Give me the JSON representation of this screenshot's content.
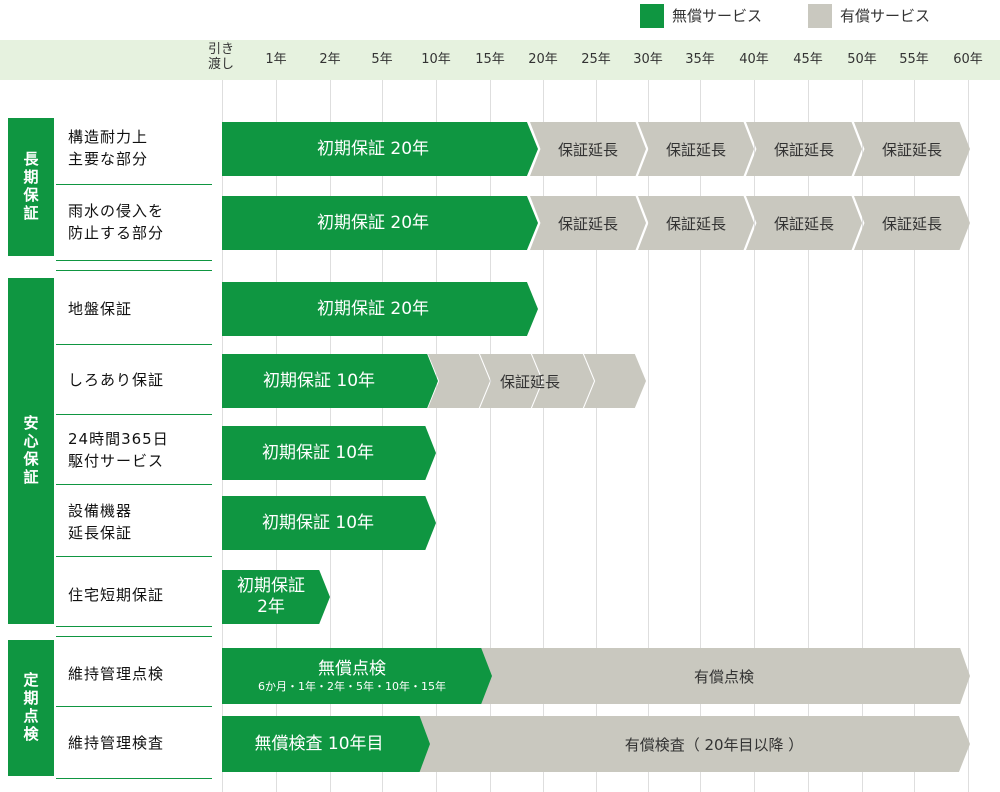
{
  "legend": {
    "free_label": "無償サービス",
    "paid_label": "有償サービス",
    "free_color": "#0f9641",
    "paid_color": "#c9c8bf"
  },
  "timeline": {
    "handover_label_line1": "引き",
    "handover_label_line2": "渡し",
    "ticks": [
      "1年",
      "2年",
      "5年",
      "10年",
      "15年",
      "20年",
      "25年",
      "30年",
      "35年",
      "40年",
      "45年",
      "50年",
      "55年",
      "60年"
    ]
  },
  "groups": [
    {
      "label": "長期保証"
    },
    {
      "label": "安心保証"
    },
    {
      "label": "定期点検"
    }
  ],
  "rows": [
    {
      "label_line1": "構造耐力上",
      "label_line2": "主要な部分"
    },
    {
      "label_line1": "雨水の侵入を",
      "label_line2": "防止する部分"
    },
    {
      "label_line1": "地盤保証",
      "label_line2": ""
    },
    {
      "label_line1": "しろあり保証",
      "label_line2": ""
    },
    {
      "label_line1": "24時間365日",
      "label_line2": "駆付サービス"
    },
    {
      "label_line1": "設備機器",
      "label_line2": "延長保証"
    },
    {
      "label_line1": "住宅短期保証",
      "label_line2": ""
    },
    {
      "label_line1": "維持管理点検",
      "label_line2": ""
    },
    {
      "label_line1": "維持管理検査",
      "label_line2": ""
    }
  ],
  "bars": {
    "struct_initial": "初期保証 20年",
    "struct_ext1": "保証延長",
    "struct_ext2": "保証延長",
    "struct_ext3": "保証延長",
    "struct_ext4": "保証延長",
    "rain_initial": "初期保証 20年",
    "rain_ext1": "保証延長",
    "rain_ext2": "保証延長",
    "rain_ext3": "保証延長",
    "rain_ext4": "保証延長",
    "ground_initial": "初期保証 20年",
    "termite_initial": "初期保証 10年",
    "termite_ext": "保証延長",
    "support_initial": "初期保証 10年",
    "equipment_initial": "初期保証 10年",
    "shortterm_line1": "初期保証",
    "shortterm_line2": "2年",
    "inspect_free": "無償点検",
    "inspect_free_sub": "6か月・1年・2年・5年・10年・15年",
    "inspect_paid": "有償点検",
    "check_free": "無償検査 10年目",
    "check_paid": "有償検査（ 20年目以降 ）"
  }
}
